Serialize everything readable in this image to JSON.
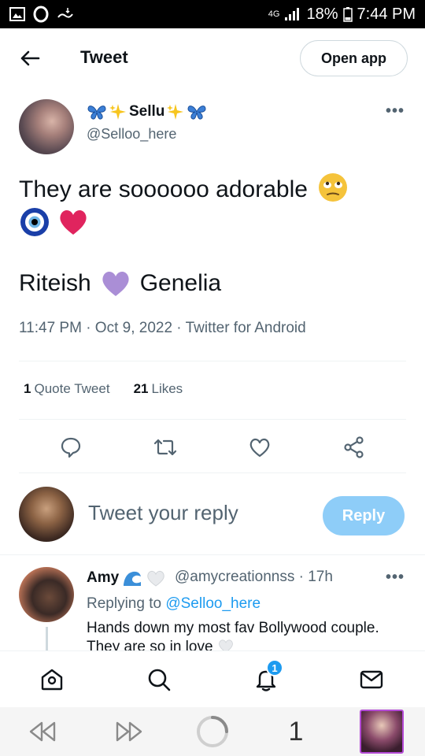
{
  "status_bar": {
    "network": "4G",
    "battery": "18%",
    "time": "7:44 PM"
  },
  "header": {
    "title": "Tweet",
    "open_app_label": "Open app"
  },
  "tweet": {
    "author_name": "Sellu",
    "author_handle": "@Selloo_here",
    "text_line1": "They are soooooo adorable",
    "text_name1": "Riteish",
    "text_name2": "Genelia",
    "meta": "11:47 PM · Oct 9, 2022 · Twitter for Android",
    "quote_count": "1",
    "quote_label": "Quote Tweet",
    "likes_count": "21",
    "likes_label": "Likes"
  },
  "composer": {
    "placeholder": "Tweet your reply",
    "reply_label": "Reply"
  },
  "reply": {
    "author_name": "Amy",
    "author_handle": "@amycreationnss · 17h",
    "replying_prefix": "Replying to",
    "replying_to": "@Selloo_here",
    "text": "Hands down my most fav Bollywood couple. They are so in love"
  },
  "tabbar": {
    "notification_badge": "1"
  },
  "browser_nav": {
    "tab_count": "1"
  },
  "colors": {
    "accent": "#1d9bf0",
    "reply_button_disabled": "#8ecdf8",
    "secondary_text": "#536471",
    "heart_red": "#e0245e",
    "purple_heart": "#aa8ed6"
  }
}
